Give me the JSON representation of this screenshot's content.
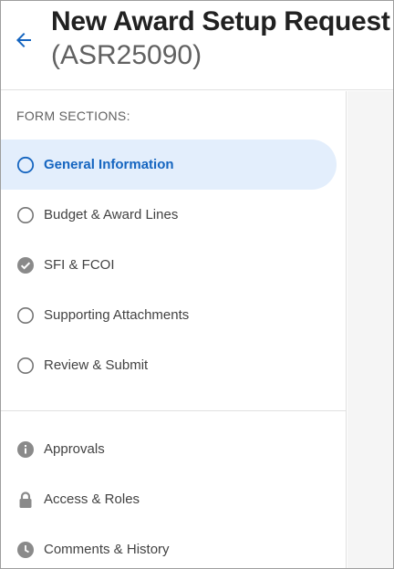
{
  "header": {
    "title": "New Award Setup Request",
    "subtitle": "(ASR25090)",
    "back_icon": "arrow-left-icon"
  },
  "sidebar": {
    "heading": "FORM SECTIONS:",
    "sections": [
      {
        "label": "General Information",
        "status": "current",
        "icon": "circle-outline-icon"
      },
      {
        "label": "Budget & Award Lines",
        "status": "incomplete",
        "icon": "circle-outline-icon"
      },
      {
        "label": "SFI & FCOI",
        "status": "complete",
        "icon": "check-circle-icon"
      },
      {
        "label": "Supporting Attachments",
        "status": "incomplete",
        "icon": "circle-outline-icon"
      },
      {
        "label": "Review & Submit",
        "status": "incomplete",
        "icon": "circle-outline-icon"
      }
    ],
    "utilities": [
      {
        "label": "Approvals",
        "icon": "info-icon"
      },
      {
        "label": "Access & Roles",
        "icon": "lock-icon"
      },
      {
        "label": "Comments & History",
        "icon": "clock-icon"
      }
    ]
  },
  "colors": {
    "accent": "#1565c0",
    "active_bg": "#e3eefc",
    "icon_gray": "#9e9e9e",
    "text": "#424242"
  }
}
